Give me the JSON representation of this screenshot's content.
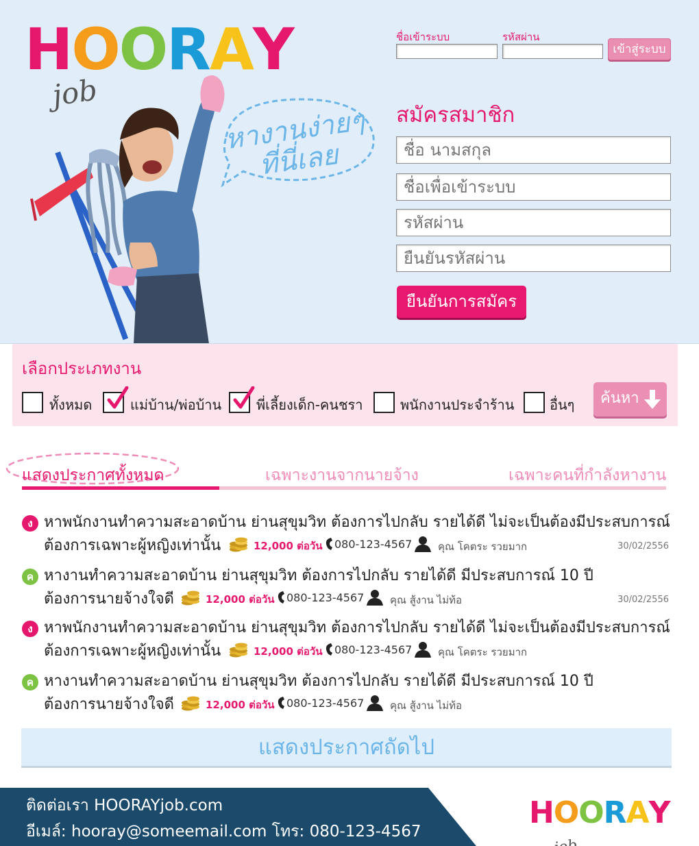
{
  "brand": {
    "letters": [
      {
        "ch": "H",
        "color": "#e6186e"
      },
      {
        "ch": "O",
        "color": "#f59c1a"
      },
      {
        "ch": "O",
        "color": "#7dc242"
      },
      {
        "ch": "R",
        "color": "#1a9ad6"
      },
      {
        "ch": "A",
        "color": "#f7c21a"
      },
      {
        "ch": "Y",
        "color": "#e6186e"
      }
    ],
    "suffix": "job",
    "accent": "#e6186e",
    "sky": "#e1eef9",
    "footer_bg": "#1b4a6b"
  },
  "bubble": {
    "line1": "หางานง่ายๆ",
    "line2": "ที่นี่เลย"
  },
  "login": {
    "username_label": "ชื่อเข้าระบบ",
    "password_label": "รหัสผ่าน",
    "submit": "เข้าสู่ระบบ"
  },
  "register": {
    "title": "สมัครสมาชิก",
    "fullname_placeholder": "ชื่อ นามสกุล",
    "username_placeholder": "ชื่อเพื่อเข้าระบบ",
    "password_placeholder": "รหัสผ่าน",
    "confirm_placeholder": "ยืนยันรหัสผ่าน",
    "submit": "ยืนยันการสมัคร"
  },
  "filter": {
    "title": "เลือกประเภทงาน",
    "options": [
      {
        "label": "ทั้งหมด",
        "checked": false
      },
      {
        "label": "แม่บ้าน/พ่อบ้าน",
        "checked": true
      },
      {
        "label": "พี่เลี้ยงเด็ก-คนชรา",
        "checked": true
      },
      {
        "label": "พนักงานประจำร้าน",
        "checked": false
      },
      {
        "label": "อื่นๆ",
        "checked": false
      }
    ],
    "search": "ค้นหา"
  },
  "tabs": {
    "all": "แสดงประกาศทั้งหมด",
    "employer": "เฉพาะงานจากนายจ้าง",
    "seeker": "เฉพาะคนที่กำลังหางาน"
  },
  "jobs": [
    {
      "badge": "ง",
      "badge_color": "#e6186e",
      "title": "หาพนักงานทำความสะอาดบ้าน ย่านสุขุมวิท ต้องการไปกลับ รายได้ดี ไม่จะเป็นต้องมีประสบการณ์",
      "sub": "ต้องการเฉพาะผู้หญิงเท่านั้น",
      "wage": "12,000 ต่อวัน",
      "phone": "080-123-4567",
      "person": "คุณ โคตระ รวยมาก",
      "date": "30/02/2556"
    },
    {
      "badge": "ค",
      "badge_color": "#7dc242",
      "title": "หางานทำความสะอาดบ้าน ย่านสุขุมวิท ต้องการไปกลับ รายได้ดี มีประสบการณ์ 10 ปี",
      "sub": "ต้องการนายจ้างใจดี",
      "wage": "12,000 ต่อวัน",
      "phone": "080-123-4567",
      "person": "คุณ สู้งาน ไม่ท้อ",
      "date": "30/02/2556"
    },
    {
      "badge": "ง",
      "badge_color": "#e6186e",
      "title": "หาพนักงานทำความสะอาดบ้าน ย่านสุขุมวิท ต้องการไปกลับ รายได้ดี ไม่จะเป็นต้องมีประสบการณ์",
      "sub": "ต้องการเฉพาะผู้หญิงเท่านั้น",
      "wage": "12,000 ต่อวัน",
      "phone": "080-123-4567",
      "person": "คุณ โคตระ รวยมาก",
      "date": ""
    },
    {
      "badge": "ค",
      "badge_color": "#7dc242",
      "title": "หางานทำความสะอาดบ้าน ย่านสุขุมวิท ต้องการไปกลับ รายได้ดี มีประสบการณ์ 10 ปี",
      "sub": "ต้องการนายจ้างใจดี",
      "wage": "12,000 ต่อวัน",
      "phone": "080-123-4567",
      "person": "คุณ สู้งาน ไม่ท้อ",
      "date": ""
    }
  ],
  "more": "แสดงประกาศถัดไป",
  "footer": {
    "contact": "ติดต่อเรา HOORAYjob.com",
    "email_phone": "อีเมล์:  hooray@someemail.com  โทร:  080-123-4567"
  }
}
